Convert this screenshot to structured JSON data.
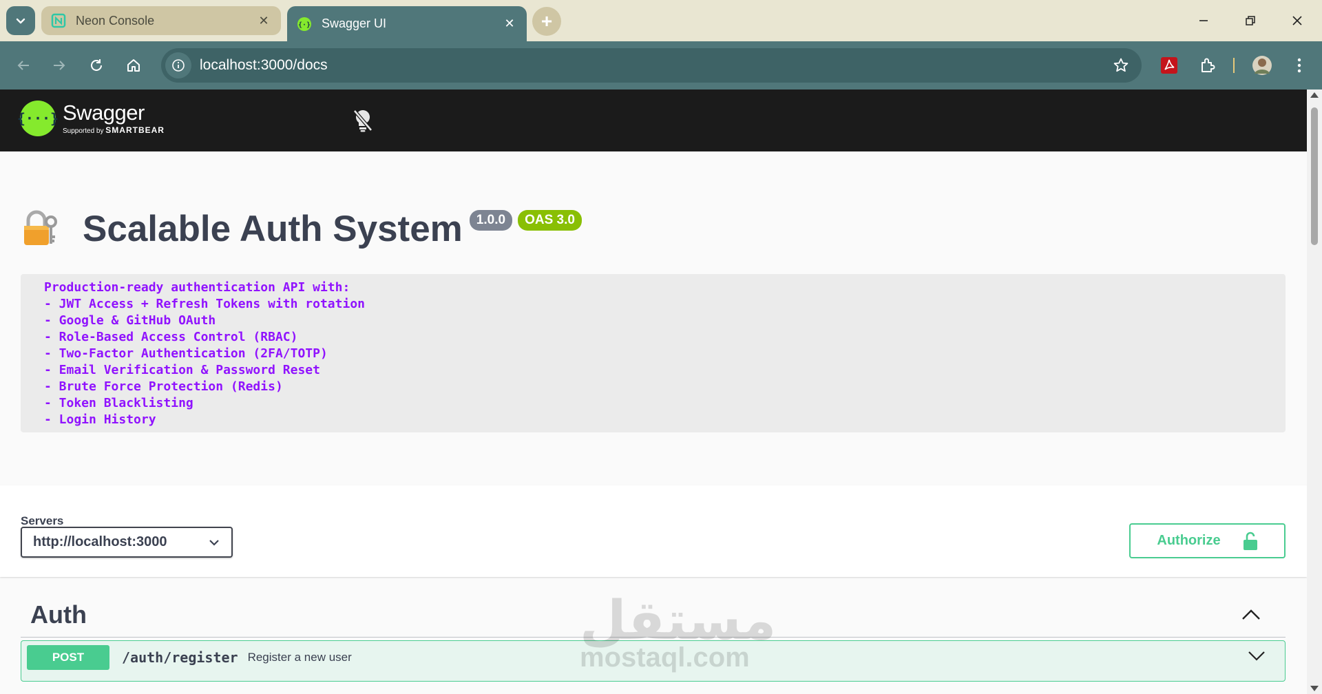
{
  "browser": {
    "tabs": [
      {
        "title": "Neon Console",
        "active": false
      },
      {
        "title": "Swagger UI",
        "active": true
      }
    ],
    "url": "localhost:3000/docs",
    "new_tab_symbol": "+",
    "colors": {
      "chrome": "#50777a",
      "tabbar": "#e9e6d2",
      "inactive_tab": "#cfc6a4"
    }
  },
  "swagger": {
    "brand": "Swagger",
    "supported_by": "Supported by",
    "smartbear": "SMARTBEAR",
    "logo_symbol": "{···}",
    "api_title": "Scalable Auth System",
    "version_badge": "1.0.0",
    "oas_badge": "OAS 3.0",
    "description_lines": [
      "Production-ready authentication API with:",
      "- JWT Access + Refresh Tokens with rotation",
      "- Google & GitHub OAuth",
      "- Role-Based Access Control (RBAC)",
      "- Two-Factor Authentication (2FA/TOTP)",
      "- Email Verification & Password Reset",
      "- Brute Force Protection (Redis)",
      "- Token Blacklisting",
      "- Login History"
    ],
    "servers_label": "Servers",
    "server_selected": "http://localhost:3000",
    "authorize_label": "Authorize",
    "tag": "Auth",
    "operations": [
      {
        "method": "POST",
        "path": "/auth/register",
        "summary": "Register a new user"
      }
    ],
    "colors": {
      "post": "#49cc90",
      "description_text": "#9012fe",
      "title": "#3b4151",
      "logo": "#85ea2d"
    }
  },
  "watermark": {
    "arabic": "مستقل",
    "latin": "mostaql.com"
  }
}
